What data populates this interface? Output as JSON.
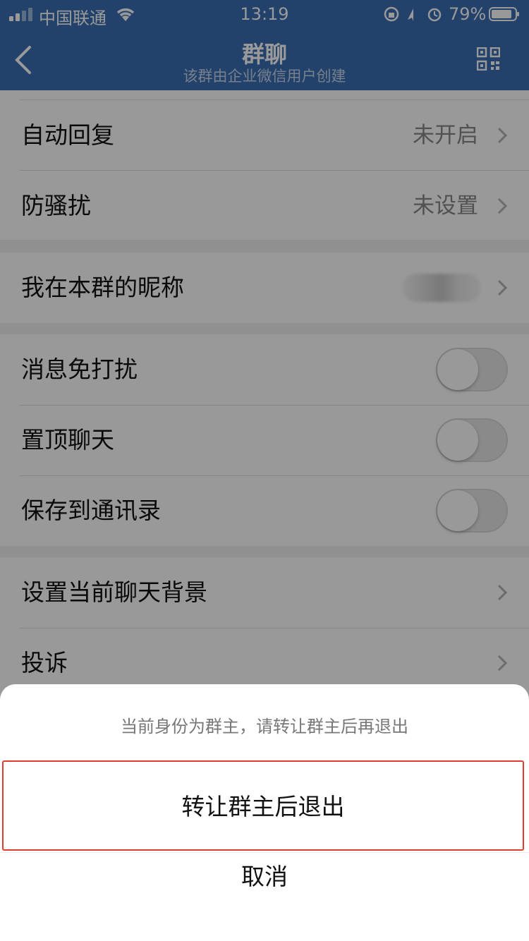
{
  "status_bar": {
    "carrier": "中国联通",
    "time": "13:19",
    "battery": "79%"
  },
  "header": {
    "title": "群聊",
    "subtitle": "该群由企业微信用户创建"
  },
  "settings": {
    "auto_reply": {
      "label": "自动回复",
      "value": "未开启"
    },
    "anti_harass": {
      "label": "防骚扰",
      "value": "未设置"
    },
    "nickname": {
      "label": "我在本群的昵称"
    },
    "mute": {
      "label": "消息免打扰",
      "on": false
    },
    "pin": {
      "label": "置顶聊天",
      "on": false
    },
    "save_contacts": {
      "label": "保存到通讯录",
      "on": false
    },
    "background": {
      "label": "设置当前聊天背景"
    },
    "complain": {
      "label": "投诉"
    }
  },
  "action_sheet": {
    "message": "当前身份为群主，请转让群主后再退出",
    "primary": "转让群主后退出",
    "cancel": "取消"
  },
  "colors": {
    "header_bg": "#3b6eb3",
    "highlight_border": "#e43b2f"
  }
}
